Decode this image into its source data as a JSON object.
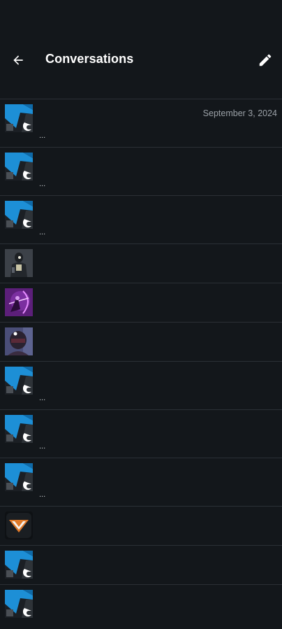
{
  "header": {
    "title": "Conversations",
    "back_icon": "arrow-left-icon",
    "compose_icon": "pencil-icon"
  },
  "colors": {
    "background": "#13171b",
    "divider": "#2b3036",
    "text_primary": "#ffffff",
    "text_secondary": "#9aa0a6"
  },
  "conversations": [
    {
      "avatar": "bungie-logo",
      "preview": "...",
      "date": "September 3, 2024"
    },
    {
      "avatar": "bungie-logo",
      "preview": "...",
      "date": ""
    },
    {
      "avatar": "bungie-logo",
      "preview": "...",
      "date": ""
    },
    {
      "avatar": "armored-character",
      "preview": "",
      "date": ""
    },
    {
      "avatar": "purple-emblem",
      "preview": "",
      "date": ""
    },
    {
      "avatar": "helmet-character",
      "preview": "",
      "date": ""
    },
    {
      "avatar": "bungie-logo",
      "preview": "...",
      "date": ""
    },
    {
      "avatar": "bungie-logo",
      "preview": "...",
      "date": ""
    },
    {
      "avatar": "bungie-logo",
      "preview": "...",
      "date": ""
    },
    {
      "avatar": "orange-chevron-emblem",
      "preview": "",
      "date": ""
    },
    {
      "avatar": "bungie-logo",
      "preview": "",
      "date": ""
    },
    {
      "avatar": "bungie-logo",
      "preview": "",
      "date": ""
    }
  ]
}
